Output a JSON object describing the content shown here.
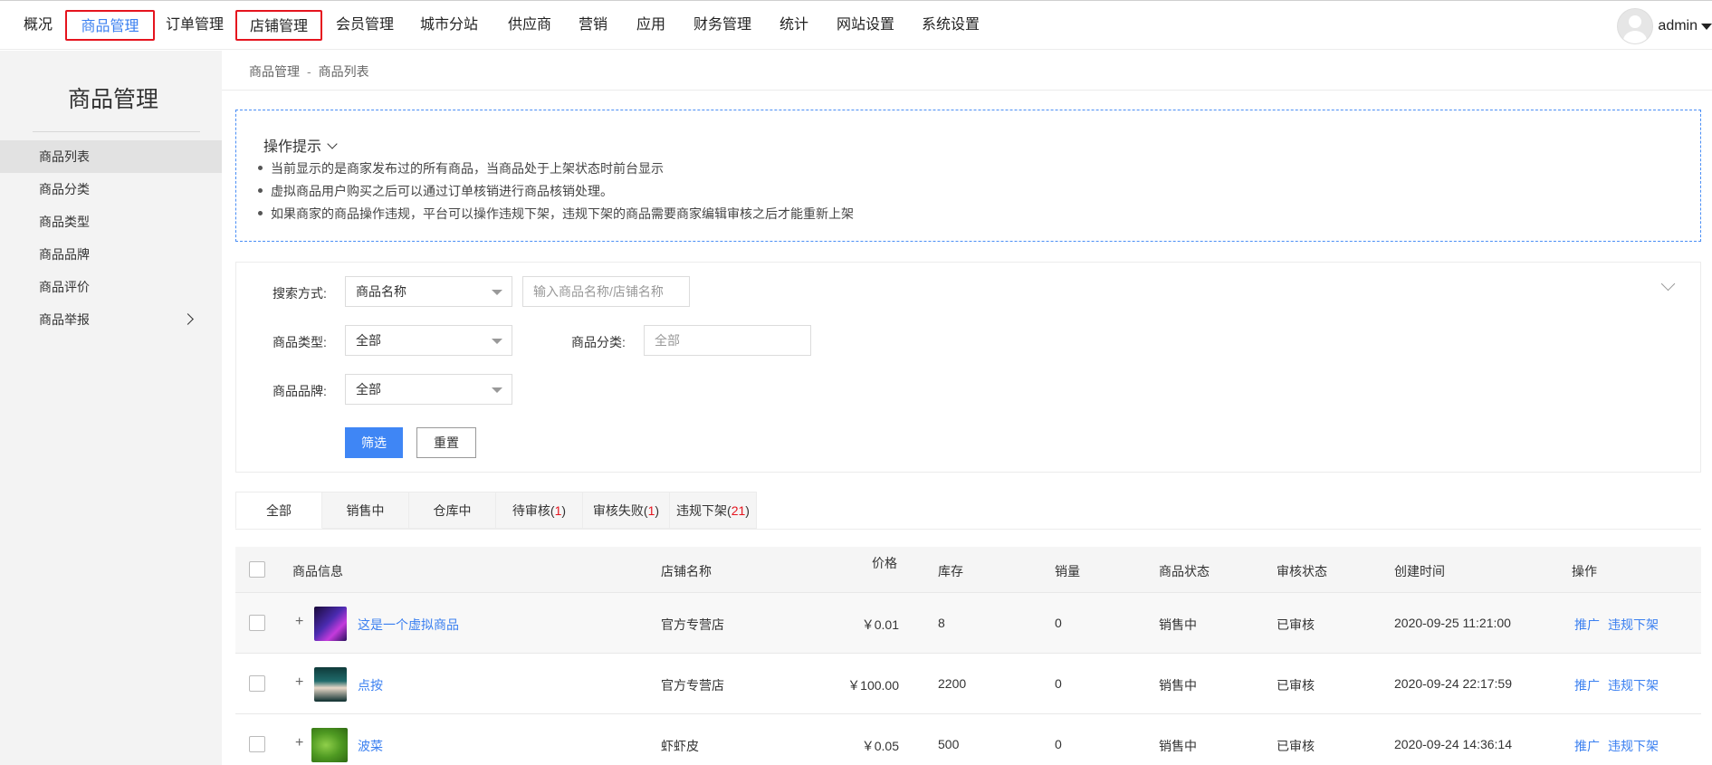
{
  "nav": {
    "items": [
      "概况",
      "商品管理",
      "订单管理",
      "店铺管理",
      "会员管理",
      "城市分站",
      "供应商",
      "营销",
      "应用",
      "财务管理",
      "统计",
      "网站设置",
      "系统设置"
    ],
    "user": "admin"
  },
  "sidebar": {
    "title": "商品管理",
    "items": [
      "商品列表",
      "商品分类",
      "商品类型",
      "商品品牌",
      "商品评价",
      "商品举报"
    ]
  },
  "breadcrumb": {
    "parent": "商品管理",
    "sep": "-",
    "current": "商品列表"
  },
  "tips": {
    "title": "操作提示",
    "lines": [
      "当前显示的是商家发布过的所有商品，当商品处于上架状态时前台显示",
      "虚拟商品用户购买之后可以通过订单核销进行商品核销处理。",
      "如果商家的商品操作违规，平台可以操作违规下架，违规下架的商品需要商家编辑审核之后才能重新上架"
    ]
  },
  "filters": {
    "search_label": "搜索方式:",
    "search_mode": "商品名称",
    "search_placeholder": "输入商品名称/店铺名称",
    "type_label": "商品类型:",
    "type_value": "全部",
    "category_label": "商品分类:",
    "category_placeholder": "全部",
    "brand_label": "商品品牌:",
    "brand_value": "全部",
    "filter_button": "筛选",
    "reset_button": "重置"
  },
  "tabs": [
    {
      "label": "全部",
      "count": ""
    },
    {
      "label": "销售中",
      "count": ""
    },
    {
      "label": "仓库中",
      "count": ""
    },
    {
      "label": "待审核",
      "count": "1"
    },
    {
      "label": "审核失败",
      "count": "1"
    },
    {
      "label": "违规下架",
      "count": "21"
    }
  ],
  "table": {
    "headers": [
      "商品信息",
      "店铺名称",
      "价格",
      "库存",
      "销量",
      "商品状态",
      "审核状态",
      "创建时间",
      "操作"
    ],
    "rows": [
      {
        "name": "这是一个虚拟商品",
        "shop": "官方专营店",
        "price": "￥0.01",
        "stock": "8",
        "sales": "0",
        "status": "销售中",
        "audit": "已审核",
        "created": "2020-09-25 11:21:00",
        "actions": [
          "推广",
          "违规下架"
        ]
      },
      {
        "name": "点按",
        "shop": "官方专营店",
        "price": "￥100.00",
        "stock": "2200",
        "sales": "0",
        "status": "销售中",
        "audit": "已审核",
        "created": "2020-09-24 22:17:59",
        "actions": [
          "推广",
          "违规下架"
        ]
      },
      {
        "name": "波菜",
        "shop": "虾虾皮",
        "price": "￥0.05",
        "stock": "500",
        "sales": "0",
        "status": "销售中",
        "audit": "已审核",
        "created": "2020-09-24 14:36:14",
        "actions": [
          "推广",
          "违规下架"
        ]
      }
    ]
  },
  "colors": {
    "accent": "#3a7ff0",
    "highlight_box": "#e5141e",
    "primary_button": "#3f86f5"
  }
}
